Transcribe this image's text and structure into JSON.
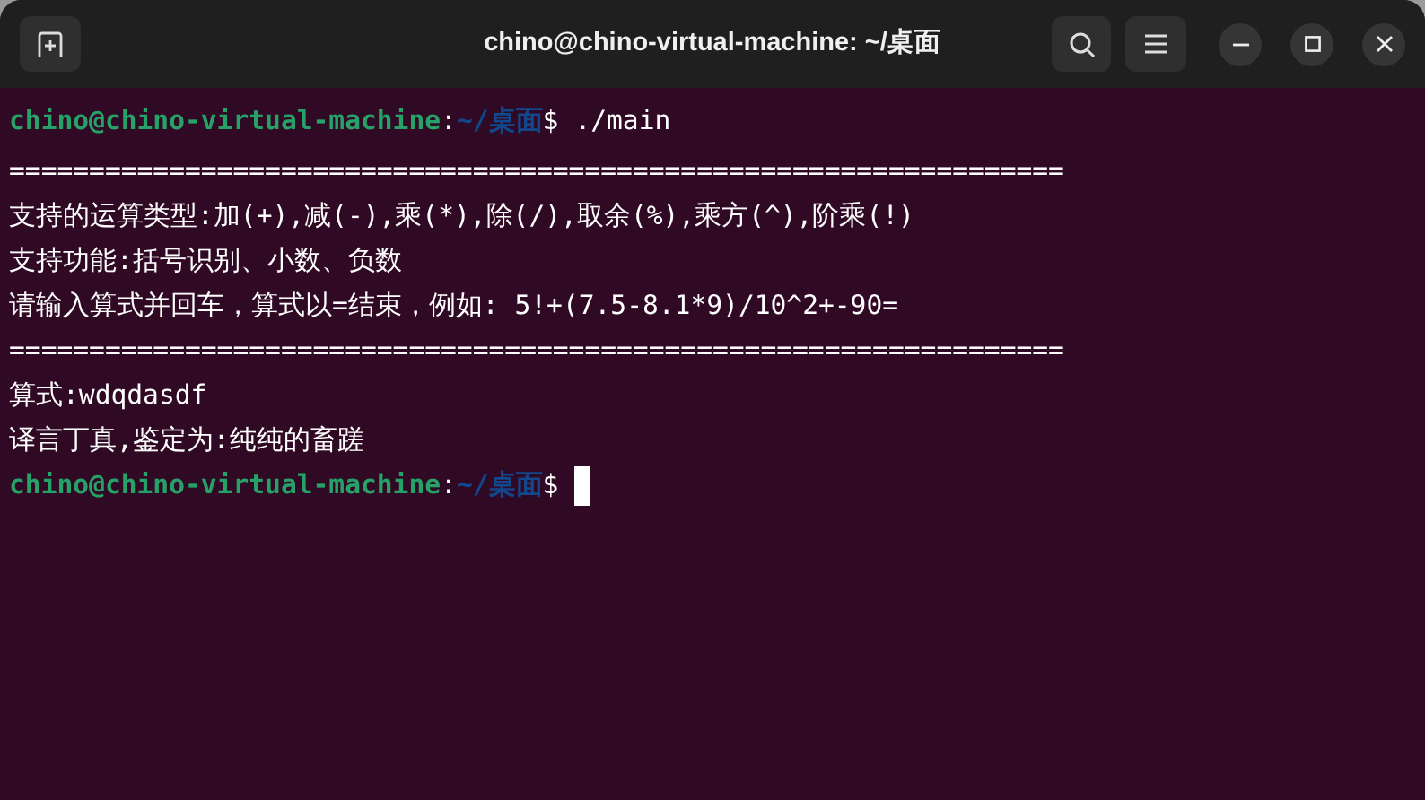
{
  "window": {
    "title": "chino@chino-virtual-machine: ~/桌面"
  },
  "terminal": {
    "lines": [
      {
        "kind": "prompt",
        "user_host": "chino@chino-virtual-machine",
        "separator": ":",
        "path": "~/桌面",
        "symbol": "$",
        "command": "./main",
        "cursor": false
      },
      {
        "kind": "output",
        "text": "=================================================================="
      },
      {
        "kind": "output",
        "text": "支持的运算类型:加(+),减(-),乘(*),除(/),取余(%),乘方(^),阶乘(!)"
      },
      {
        "kind": "output",
        "text": "支持功能:括号识别、小数、负数"
      },
      {
        "kind": "output",
        "text": "请输入算式并回车，算式以=结束，例如: 5!+(7.5-8.1*9)/10^2+-90="
      },
      {
        "kind": "output",
        "text": "=================================================================="
      },
      {
        "kind": "output",
        "text": "算式:wdqdasdf"
      },
      {
        "kind": "output",
        "text": "译言丁真,鉴定为:纯纯的畜蹉"
      },
      {
        "kind": "prompt",
        "user_host": "chino@chino-virtual-machine",
        "separator": ":",
        "path": "~/桌面",
        "symbol": "$",
        "cursor": true
      }
    ]
  }
}
